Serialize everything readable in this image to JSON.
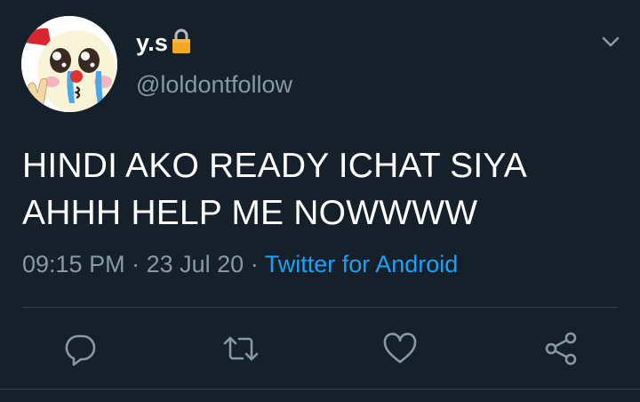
{
  "user": {
    "display_name": "y.s",
    "handle": "@loldontfollow",
    "avatar_icon": "pleading-crying-face-emoji-icon",
    "lock_icon": "lock-icon"
  },
  "tweet": {
    "lines": [
      "HINDI AKO READY ICHAT SIYA",
      "AHHH HELP ME NOWWWW"
    ],
    "time": "09:15 PM",
    "date": "23 Jul 20",
    "separator": "·",
    "source": "Twitter for Android"
  },
  "actions": {
    "reply_icon": "reply-icon",
    "retweet_icon": "retweet-icon",
    "like_icon": "heart-icon",
    "share_icon": "share-icon",
    "menu_icon": "chevron-down-icon"
  },
  "colors": {
    "background": "#15202b",
    "text": "#ffffff",
    "muted": "#8899a6",
    "link": "#1da1f2",
    "divider": "#38444d"
  }
}
